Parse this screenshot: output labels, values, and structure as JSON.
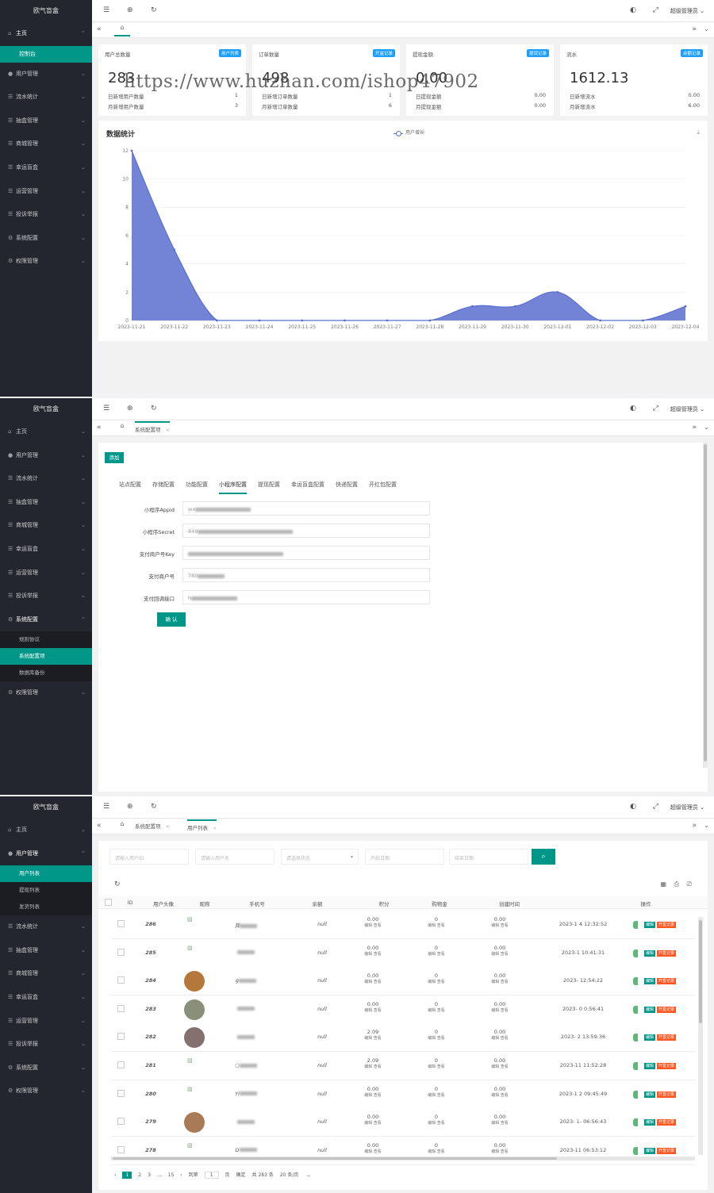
{
  "brand": "欧气盲盒",
  "watermark": "https://www.huzhan.com/ishop47902",
  "user_label": "超级管理员",
  "topbar_icons": [
    "menu-icon",
    "globe-icon",
    "refresh-icon",
    "theme-icon",
    "fullscreen-icon"
  ],
  "panel1": {
    "menu": [
      {
        "label": "主页",
        "icon": "home-icon"
      },
      {
        "label": "控制台",
        "icon": ""
      },
      {
        "label": "用户管理",
        "icon": "user-icon"
      },
      {
        "label": "流水统计",
        "icon": "list-icon"
      },
      {
        "label": "抽盒管理",
        "icon": "list-icon"
      },
      {
        "label": "商城管理",
        "icon": "list-icon"
      },
      {
        "label": "幸运盲盒",
        "icon": "list-icon"
      },
      {
        "label": "运营管理",
        "icon": "list-icon"
      },
      {
        "label": "投诉举报",
        "icon": "list-icon"
      },
      {
        "label": "系统配置",
        "icon": "gear-icon"
      },
      {
        "label": "权限管理",
        "icon": "gear-icon"
      }
    ],
    "stats": [
      {
        "title": "用户总数量",
        "badge": "用户列表",
        "value": "283",
        "r1_label": "日新增用户数量",
        "r1_value": "1",
        "r2_label": "月新增用户数量",
        "r2_value": "3",
        "badge_color": "#1e9fff"
      },
      {
        "title": "订单数量",
        "badge": "开盒记录",
        "value": "498",
        "r1_label": "日新增订单数量",
        "r1_value": "1",
        "r2_label": "月新增订单数量",
        "r2_value": "6",
        "badge_color": "#1e9fff"
      },
      {
        "title": "提现金额",
        "badge": "提现记录",
        "value": "0.00",
        "r1_label": "日提现金额",
        "r1_value": "0.00",
        "r2_label": "月提现金额",
        "r2_value": "0.00",
        "badge_color": "#1e9fff"
      },
      {
        "title": "流水",
        "badge": "余额记录",
        "value": "1612.13",
        "r1_label": "日新增流水",
        "r1_value": "0.00",
        "r2_label": "月新增流水",
        "r2_value": "6.00",
        "badge_color": "#1e9fff"
      }
    ],
    "chart_title": "数据统计"
  },
  "chart_data": {
    "type": "area",
    "title": "数据统计",
    "categories": [
      "2023-11-21",
      "2023-11-22",
      "2023-11-23",
      "2023-11-24",
      "2023-11-25",
      "2023-11-26",
      "2023-11-27",
      "2023-11-28",
      "2023-11-29",
      "2023-11-30",
      "2023-12-01",
      "2023-12-02",
      "2023-12-03",
      "2023-12-04"
    ],
    "series": [
      {
        "name": "用户增长",
        "values": [
          12,
          5,
          0,
          0,
          0,
          0,
          0,
          0,
          1,
          1,
          2,
          0,
          0,
          1
        ]
      }
    ],
    "yticks": [
      0,
      2,
      4,
      6,
      8,
      10,
      12
    ],
    "ylim": [
      0,
      12
    ],
    "color": "#5b6fcf",
    "legend": "top-center",
    "grid": true
  },
  "panel2": {
    "menu": [
      {
        "label": "主页",
        "icon": "home-icon"
      },
      {
        "label": "用户管理",
        "icon": "user-icon"
      },
      {
        "label": "流水统计",
        "icon": "list-icon"
      },
      {
        "label": "抽盒管理",
        "icon": "list-icon"
      },
      {
        "label": "商城管理",
        "icon": "list-icon"
      },
      {
        "label": "幸运盲盒",
        "icon": "list-icon"
      },
      {
        "label": "运营管理",
        "icon": "list-icon"
      },
      {
        "label": "投诉举报",
        "icon": "list-icon"
      },
      {
        "label": "系统配置",
        "icon": "gear-icon"
      }
    ],
    "submenu": [
      "规则协议",
      "系统配置项",
      "数据库备份"
    ],
    "menu_after": {
      "label": "权限管理",
      "icon": "gear-icon"
    },
    "tab_label": "系统配置项",
    "add_btn": "添加",
    "cfg_tabs": [
      "站点配置",
      "存储配置",
      "功能配置",
      "小程序配置",
      "提现配置",
      "幸运盲盒配置",
      "快递配置",
      "开红包配置"
    ],
    "fields": [
      {
        "label": "小程序Appid",
        "value": "wx"
      },
      {
        "label": "小程序Secret",
        "value": "849"
      },
      {
        "label": "支付商户号Key",
        "value": ""
      },
      {
        "label": "支付商户号",
        "value": "780"
      },
      {
        "label": "支付回调接口",
        "value": "h"
      }
    ],
    "confirm_btn": "确 认"
  },
  "panel3": {
    "menu": [
      {
        "label": "主页",
        "icon": "home-icon"
      },
      {
        "label": "用户管理",
        "icon": "user-icon"
      }
    ],
    "submenu": [
      "用户列表",
      "提现列表",
      "发货列表"
    ],
    "menu_after": [
      {
        "label": "流水统计",
        "icon": "list-icon"
      },
      {
        "label": "抽盒管理",
        "icon": "list-icon"
      },
      {
        "label": "商城管理",
        "icon": "list-icon"
      },
      {
        "label": "幸运盲盒",
        "icon": "list-icon"
      },
      {
        "label": "运营管理",
        "icon": "list-icon"
      },
      {
        "label": "投诉举报",
        "icon": "list-icon"
      },
      {
        "label": "系统配置",
        "icon": "gear-icon"
      },
      {
        "label": "权限管理",
        "icon": "gear-icon"
      }
    ],
    "tabs": [
      "系统配置项",
      "用户列表"
    ],
    "search": {
      "p1": "请输入用户ID",
      "p2": "请输入用户名",
      "p3": "请选择状态",
      "p4": "开始日期",
      "p5": "结束日期"
    },
    "columns": [
      "ID",
      "用户头像",
      "昵称",
      "手机号",
      "余额",
      "积分",
      "购物金",
      "创建时间",
      "",
      "操作"
    ],
    "rows": [
      {
        "id": "286",
        "nick": "我",
        "phone": "null",
        "bal": "0.00",
        "pts": "0",
        "shop": "0.00",
        "time": "2023-1    4 12:32:52",
        "av": ""
      },
      {
        "id": "285",
        "nick": "",
        "phone": "null",
        "bal": "0.00",
        "pts": "0",
        "shop": "0.00",
        "time": "2023-1     10:41:31",
        "av": ""
      },
      {
        "id": "284",
        "nick": "g",
        "phone": "null",
        "bal": "0.00",
        "pts": "0",
        "shop": "0.00",
        "time": "2023-    12:54:22",
        "av": "#b5773a"
      },
      {
        "id": "283",
        "nick": "",
        "phone": "null",
        "bal": "0.00",
        "pts": "0",
        "shop": "0.00",
        "time": "2023-  0   0:56:41",
        "av": "#8a8f79"
      },
      {
        "id": "282",
        "nick": "",
        "phone": "null",
        "bal": "2.09",
        "pts": "0",
        "shop": "0.00",
        "time": "2023-  2  13:59:36",
        "av": "#857070"
      },
      {
        "id": "281",
        "nick": "○",
        "phone": "null",
        "bal": "2.09",
        "pts": "0",
        "shop": "0.00",
        "time": "2023-11   11:52:28",
        "av": ""
      },
      {
        "id": "280",
        "nick": "Yi",
        "phone": "null",
        "bal": "0.00",
        "pts": "0",
        "shop": "0.00",
        "time": "2023-1  2  09:45:49",
        "av": ""
      },
      {
        "id": "279",
        "nick": "",
        "phone": "null",
        "bal": "0.00",
        "pts": "0",
        "shop": "0.00",
        "time": "2023-  1-   06:56:43",
        "av": "#a87a55"
      },
      {
        "id": "278",
        "nick": "D",
        "phone": "null",
        "bal": "0.00",
        "pts": "0",
        "shop": "0.00",
        "time": "2023-11   06:53:12",
        "av": ""
      }
    ],
    "row_btn_edit": "编辑",
    "row_btn_view": "查看",
    "op_edit": "编辑",
    "op_record": "开盒记录",
    "pager": {
      "pages": [
        "1",
        "2",
        "3",
        "...",
        "15"
      ],
      "goto": "到第",
      "page_val": "1",
      "page_unit": "页",
      "ok": "确定",
      "total": "共 283 条",
      "per": "20 条/页"
    }
  }
}
